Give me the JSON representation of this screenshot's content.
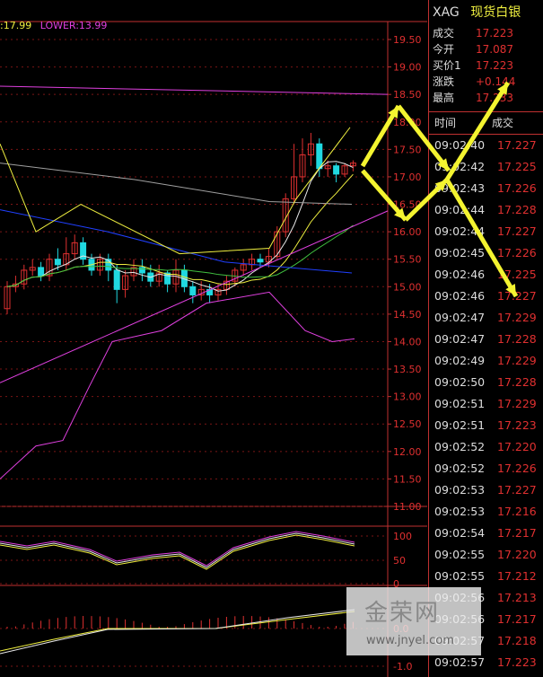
{
  "symbol": "XAG",
  "name": "现货白银",
  "bands_legend": {
    "upper_label": ":17.99",
    "lower_label": "LOWER:13.99"
  },
  "colors": {
    "up": "#e03030",
    "down": "#20d8e0",
    "ma_white": "#e8e8e8",
    "ma_yellow": "#f0f040",
    "ma_magenta": "#e040e0",
    "ma_green": "#40c040",
    "ma_blue": "#2040ff",
    "arrow": "#f4f430"
  },
  "quote": [
    {
      "label": "成交",
      "value": "17.223"
    },
    {
      "label": "今开",
      "value": "17.087"
    },
    {
      "label": "买价1",
      "value": "17.223"
    },
    {
      "label": "涨跌",
      "value": "+0.144"
    },
    {
      "label": "最高",
      "value": "17.233"
    }
  ],
  "ticks_header": {
    "time": "时间",
    "price": "成交"
  },
  "ticks": [
    {
      "time": "09:02:40",
      "price": "17.227"
    },
    {
      "time": "09:02:42",
      "price": "17.225"
    },
    {
      "time": "09:02:43",
      "price": "17.226"
    },
    {
      "time": "09:02:44",
      "price": "17.228"
    },
    {
      "time": "09:02:44",
      "price": "17.227"
    },
    {
      "time": "09:02:45",
      "price": "17.226"
    },
    {
      "time": "09:02:46",
      "price": "17.225"
    },
    {
      "time": "09:02:46",
      "price": "17.227"
    },
    {
      "time": "09:02:47",
      "price": "17.229"
    },
    {
      "time": "09:02:47",
      "price": "17.228"
    },
    {
      "time": "09:02:49",
      "price": "17.229"
    },
    {
      "time": "09:02:50",
      "price": "17.228"
    },
    {
      "time": "09:02:51",
      "price": "17.229"
    },
    {
      "time": "09:02:51",
      "price": "17.223"
    },
    {
      "time": "09:02:52",
      "price": "17.220"
    },
    {
      "time": "09:02:52",
      "price": "17.226"
    },
    {
      "time": "09:02:53",
      "price": "17.227"
    },
    {
      "time": "09:02:53",
      "price": "17.216"
    },
    {
      "time": "09:02:54",
      "price": "17.217"
    },
    {
      "time": "09:02:55",
      "price": "17.220"
    },
    {
      "time": "09:02:55",
      "price": "17.212"
    },
    {
      "time": "09:02:56",
      "price": "17.213"
    },
    {
      "time": "09:02:56",
      "price": "17.217"
    },
    {
      "time": "09:02:57",
      "price": "17.218"
    },
    {
      "time": "09:02:57",
      "price": "17.223"
    }
  ],
  "price_axis": {
    "ticks": [
      "19.50",
      "19.00",
      "18.50",
      "18.00",
      "17.50",
      "17.00",
      "16.50",
      "16.00",
      "15.50",
      "15.00",
      "14.50",
      "14.00",
      "13.50",
      "13.00",
      "12.50",
      "12.00",
      "11.50",
      "11.00"
    ],
    "min": 11.0,
    "max": 19.5
  },
  "kdj_axis": {
    "ticks": [
      "100",
      "50",
      "0"
    ]
  },
  "macd_axis": {
    "ticks": [
      "0.0",
      "-1.0"
    ]
  },
  "candles": [
    [
      14.6,
      15.0,
      14.5,
      15.1
    ],
    [
      15.0,
      15.05,
      14.9,
      15.2
    ],
    [
      15.05,
      15.3,
      14.95,
      15.4
    ],
    [
      15.3,
      15.35,
      15.2,
      15.5
    ],
    [
      15.35,
      15.2,
      15.1,
      15.45
    ],
    [
      15.2,
      15.5,
      15.1,
      15.6
    ],
    [
      15.5,
      15.4,
      15.3,
      15.7
    ],
    [
      15.4,
      15.6,
      15.3,
      15.9
    ],
    [
      15.6,
      15.8,
      15.5,
      15.95
    ],
    [
      15.8,
      15.5,
      15.4,
      15.9
    ],
    [
      15.5,
      15.3,
      15.2,
      15.6
    ],
    [
      15.3,
      15.5,
      15.2,
      15.6
    ],
    [
      15.5,
      15.3,
      15.1,
      15.6
    ],
    [
      15.3,
      14.95,
      14.7,
      15.4
    ],
    [
      14.95,
      15.2,
      14.8,
      15.3
    ],
    [
      15.2,
      15.35,
      15.1,
      15.5
    ],
    [
      15.35,
      15.25,
      15.1,
      15.5
    ],
    [
      15.25,
      15.1,
      15.0,
      15.4
    ],
    [
      15.1,
      15.25,
      15.0,
      15.4
    ],
    [
      15.25,
      15.05,
      14.9,
      15.3
    ],
    [
      15.05,
      15.3,
      14.9,
      15.5
    ],
    [
      15.3,
      15.0,
      14.9,
      15.4
    ],
    [
      15.0,
      14.85,
      14.7,
      15.1
    ],
    [
      14.85,
      14.95,
      14.75,
      15.1
    ],
    [
      14.95,
      14.85,
      14.7,
      15.05
    ],
    [
      14.85,
      14.95,
      14.75,
      15.05
    ],
    [
      14.95,
      15.1,
      14.85,
      15.2
    ],
    [
      15.1,
      15.3,
      15.0,
      15.35
    ],
    [
      15.3,
      15.4,
      15.2,
      15.5
    ],
    [
      15.4,
      15.5,
      15.3,
      15.6
    ],
    [
      15.5,
      15.45,
      15.35,
      15.6
    ],
    [
      15.45,
      15.55,
      15.35,
      15.7
    ],
    [
      15.55,
      16.0,
      15.5,
      16.1
    ],
    [
      16.0,
      16.6,
      15.9,
      16.7
    ],
    [
      16.6,
      17.0,
      16.5,
      17.6
    ],
    [
      17.0,
      17.4,
      16.9,
      17.7
    ],
    [
      17.4,
      17.6,
      17.2,
      17.8
    ],
    [
      17.6,
      17.15,
      17.0,
      17.7
    ],
    [
      17.15,
      17.2,
      17.0,
      17.3
    ],
    [
      17.2,
      17.05,
      16.9,
      17.25
    ],
    [
      17.05,
      17.2,
      17.0,
      17.25
    ],
    [
      17.2,
      17.25,
      17.1,
      17.3
    ]
  ],
  "arrows": [
    {
      "from": [
        404,
        185
      ],
      "to": [
        444,
        118
      ]
    },
    {
      "from": [
        444,
        118
      ],
      "to": [
        500,
        190
      ]
    },
    {
      "from": [
        404,
        190
      ],
      "to": [
        452,
        245
      ]
    },
    {
      "from": [
        452,
        245
      ],
      "to": [
        498,
        200
      ]
    },
    {
      "from": [
        498,
        200
      ],
      "to": [
        566,
        92
      ]
    },
    {
      "from": [
        498,
        200
      ],
      "to": [
        575,
        330
      ]
    }
  ]
}
